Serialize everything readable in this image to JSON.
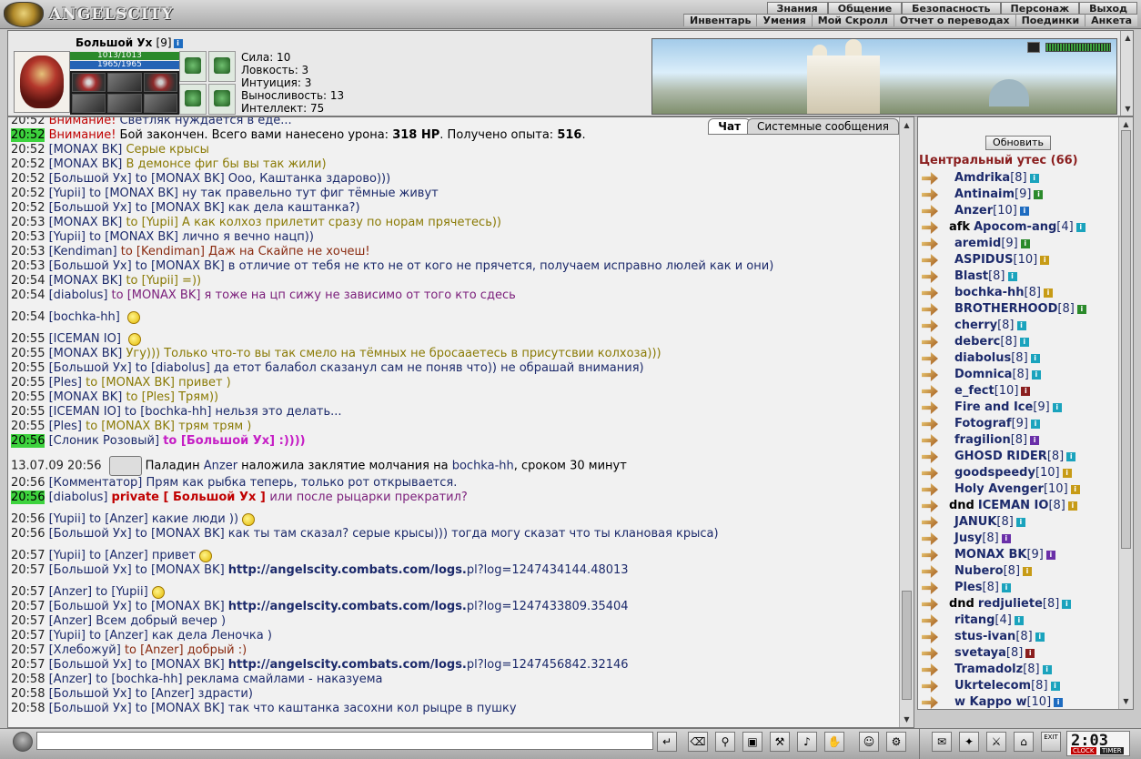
{
  "app": {
    "logo_text": "ANGELSCITY"
  },
  "menu": {
    "row1": [
      "Знания",
      "Общение",
      "Безопасность",
      "Персонаж",
      "Выход"
    ],
    "row2": [
      "Инвентарь",
      "Умения",
      "Мой Скролл",
      "Отчет о переводах",
      "Поединки",
      "Анкета"
    ]
  },
  "character": {
    "name": "Большой Ух",
    "level": "[9]",
    "hp": "1013/1013",
    "mana": "1965/1965",
    "stats": [
      "Сила: 10",
      "Ловкость: 3",
      "Интуиция: 3",
      "Выносливость: 13",
      "Интеллект: 75"
    ]
  },
  "chat": {
    "tabs": [
      "Чат",
      "Системные сообщения"
    ],
    "lines": [
      {
        "time": "20:52",
        "hl": false,
        "parts": [
          {
            "c": "red",
            "t": "Внимание! "
          },
          {
            "c": "msg",
            "t": "Светляк нуждается в еде..."
          }
        ]
      },
      {
        "time": "20:52",
        "hl": true,
        "parts": [
          {
            "c": "red",
            "t": "Внимание! "
          },
          {
            "c": "",
            "t": "Бой закончен. Всего вами нанесено урона: "
          },
          {
            "c": "bold",
            "t": "318 HP"
          },
          {
            "c": "",
            "t": ". Получено опыта: "
          },
          {
            "c": "bold",
            "t": "516"
          },
          {
            "c": "",
            "t": "."
          }
        ]
      },
      {
        "time": "20:52",
        "hl": false,
        "parts": [
          {
            "c": "nick",
            "t": "[MONAX BK] "
          },
          {
            "c": "olive",
            "t": "Серые крысы"
          }
        ]
      },
      {
        "time": "20:52",
        "hl": false,
        "parts": [
          {
            "c": "nick",
            "t": "[MONAX BK] "
          },
          {
            "c": "olive",
            "t": "В демонсе фиг бы вы так жили)"
          }
        ]
      },
      {
        "time": "20:52",
        "hl": false,
        "parts": [
          {
            "c": "nick",
            "t": "[Большой Ух] "
          },
          {
            "c": "to",
            "t": "to [MONAX BK] Ооо, Каштанка здарово)))"
          }
        ]
      },
      {
        "time": "20:52",
        "hl": false,
        "parts": [
          {
            "c": "nick",
            "t": "[Yupii] "
          },
          {
            "c": "to",
            "t": "to [MONAX BK] ну так правельно тут фиг тёмные живут"
          }
        ]
      },
      {
        "time": "20:52",
        "hl": false,
        "parts": [
          {
            "c": "nick",
            "t": "[Большой Ух] "
          },
          {
            "c": "to",
            "t": "to [MONAX BK] как дела каштанка?)"
          }
        ]
      },
      {
        "time": "20:53",
        "hl": false,
        "parts": [
          {
            "c": "nick",
            "t": "[MONAX BK] "
          },
          {
            "c": "olive",
            "t": "to [Yupii] А как колхоз прилетит сразу по норам прячетесь))"
          }
        ]
      },
      {
        "time": "20:53",
        "hl": false,
        "parts": [
          {
            "c": "nick",
            "t": "[Yupii] "
          },
          {
            "c": "to",
            "t": "to [MONAX BK] лично я вечно нацп))"
          }
        ]
      },
      {
        "time": "20:53",
        "hl": false,
        "parts": [
          {
            "c": "nick",
            "t": "[Kendiman] "
          },
          {
            "c": "brown",
            "t": "to [Kendiman] Даж на Скайпе не хочеш!"
          }
        ]
      },
      {
        "time": "20:53",
        "hl": false,
        "parts": [
          {
            "c": "nick",
            "t": "[Большой Ух] "
          },
          {
            "c": "to",
            "t": "to [MONAX BK] в отличие от тебя не кто не от кого не прячется, получаем исправно люлей как и они)"
          }
        ]
      },
      {
        "time": "20:54",
        "hl": false,
        "parts": [
          {
            "c": "nick",
            "t": "[MONAX BK] "
          },
          {
            "c": "olive",
            "t": "to [Yupii] =))"
          }
        ]
      },
      {
        "time": "20:54",
        "hl": false,
        "parts": [
          {
            "c": "nick",
            "t": "[diabolus] "
          },
          {
            "c": "purple",
            "t": "to [MONAX BK] я тоже на цп сижу не зависимо от того кто сдесь"
          }
        ]
      },
      {
        "time": "20:54",
        "hl": false,
        "tall": true,
        "smiley": true,
        "parts": [
          {
            "c": "nick",
            "t": "[bochka-hh] "
          }
        ]
      },
      {
        "time": "20:55",
        "hl": false,
        "tall": true,
        "smiley": true,
        "parts": [
          {
            "c": "nick",
            "t": "[ICEMAN IO] "
          }
        ]
      },
      {
        "time": "20:55",
        "hl": false,
        "parts": [
          {
            "c": "nick",
            "t": "[MONAX BK] "
          },
          {
            "c": "olive",
            "t": "Угу))) Только что-то вы так смело на тёмных не бросааетесь в присутсвии колхоза)))"
          }
        ]
      },
      {
        "time": "20:55",
        "hl": false,
        "parts": [
          {
            "c": "nick",
            "t": "[Большой Ух] "
          },
          {
            "c": "to",
            "t": "to [diabolus] да етот балабол сказанул сам не поняв что)) не обрашай внимания)"
          }
        ]
      },
      {
        "time": "20:55",
        "hl": false,
        "parts": [
          {
            "c": "nick",
            "t": "[Ples] "
          },
          {
            "c": "olive",
            "t": "to [MONAX BK] привет )"
          }
        ]
      },
      {
        "time": "20:55",
        "hl": false,
        "parts": [
          {
            "c": "nick",
            "t": "[MONAX BK] "
          },
          {
            "c": "olive",
            "t": "to [Ples] Трям))"
          }
        ]
      },
      {
        "time": "20:55",
        "hl": false,
        "parts": [
          {
            "c": "nick",
            "t": "[ICEMAN IO] "
          },
          {
            "c": "to",
            "t": "to [bochka-hh] нельзя это делать..."
          }
        ]
      },
      {
        "time": "20:55",
        "hl": false,
        "parts": [
          {
            "c": "nick",
            "t": "[Ples] "
          },
          {
            "c": "olive",
            "t": "to [MONAX BK] трям трям )"
          }
        ]
      },
      {
        "time": "20:56",
        "hl": true,
        "parts": [
          {
            "c": "nick",
            "t": "[Слоник Розовый] "
          },
          {
            "c": "magenta",
            "t": "to [Большой Ух]"
          },
          {
            "c": "magenta",
            "t": " :))))"
          }
        ]
      },
      {
        "time": "13.07.09 20:56",
        "hl": false,
        "tall": true,
        "emblem": true,
        "parts": [
          {
            "c": "",
            "t": "Паладин "
          },
          {
            "c": "nick",
            "t": "Anzer"
          },
          {
            "c": "",
            "t": " наложила заклятие молчания на "
          },
          {
            "c": "nick",
            "t": "bochka-hh"
          },
          {
            "c": "",
            "t": ", сроком 30 минут"
          }
        ]
      },
      {
        "time": "20:56",
        "hl": false,
        "parts": [
          {
            "c": "nick",
            "t": "[Комментатор] "
          },
          {
            "c": "msg",
            "t": "Прям как рыбка теперь, только рот открывается."
          }
        ]
      },
      {
        "time": "20:56",
        "hl": true,
        "parts": [
          {
            "c": "nick",
            "t": "[diabolus] "
          },
          {
            "c": "private",
            "t": "private [ Большой Ух ] "
          },
          {
            "c": "purple",
            "t": "или после рыцарки прекратил?"
          }
        ]
      },
      {
        "time": "20:56",
        "hl": false,
        "tall": true,
        "smiley": true,
        "parts": [
          {
            "c": "nick",
            "t": "[Yupii] "
          },
          {
            "c": "to",
            "t": "to [Anzer] какие люди ))"
          }
        ]
      },
      {
        "time": "20:56",
        "hl": false,
        "parts": [
          {
            "c": "nick",
            "t": "[Большой Ух] "
          },
          {
            "c": "to",
            "t": "to [MONAX BK] как ты там сказал? серые крысы))) тогда могу сказат что ты клановая крыса)"
          }
        ]
      },
      {
        "time": "20:57",
        "hl": false,
        "tall": true,
        "smiley": true,
        "parts": [
          {
            "c": "nick",
            "t": "[Yupii] "
          },
          {
            "c": "to",
            "t": "to [Anzer] привет"
          }
        ]
      },
      {
        "time": "20:57",
        "hl": false,
        "parts": [
          {
            "c": "nick",
            "t": "[Большой Ух] "
          },
          {
            "c": "to",
            "t": "to [MONAX BK] "
          },
          {
            "c": "url",
            "t": "http://angelscity.combats.com/logs."
          },
          {
            "c": "to",
            "t": "pl?log=1247434144.48013"
          }
        ]
      },
      {
        "time": "20:57",
        "hl": false,
        "tall": true,
        "smiley": true,
        "parts": [
          {
            "c": "nick",
            "t": "[Anzer] "
          },
          {
            "c": "to",
            "t": "to [Yupii]"
          }
        ]
      },
      {
        "time": "20:57",
        "hl": false,
        "parts": [
          {
            "c": "nick",
            "t": "[Большой Ух] "
          },
          {
            "c": "to",
            "t": "to [MONAX BK] "
          },
          {
            "c": "url",
            "t": "http://angelscity.combats.com/logs."
          },
          {
            "c": "to",
            "t": "pl?log=1247433809.35404"
          }
        ]
      },
      {
        "time": "20:57",
        "hl": false,
        "parts": [
          {
            "c": "nick",
            "t": "[Anzer] "
          },
          {
            "c": "msg",
            "t": "Всем добрый вечер )"
          }
        ]
      },
      {
        "time": "20:57",
        "hl": false,
        "parts": [
          {
            "c": "nick",
            "t": "[Yupii] "
          },
          {
            "c": "to",
            "t": "to [Anzer] как дела Леночка )"
          }
        ]
      },
      {
        "time": "20:57",
        "hl": false,
        "parts": [
          {
            "c": "nick",
            "t": "[Хлебожуй] "
          },
          {
            "c": "brown",
            "t": "to [Anzer] добрый :)"
          }
        ]
      },
      {
        "time": "20:57",
        "hl": false,
        "parts": [
          {
            "c": "nick",
            "t": "[Большой Ух] "
          },
          {
            "c": "to",
            "t": "to [MONAX BK] "
          },
          {
            "c": "url",
            "t": "http://angelscity.combats.com/logs."
          },
          {
            "c": "to",
            "t": "pl?log=1247456842.32146"
          }
        ]
      },
      {
        "time": "20:58",
        "hl": false,
        "parts": [
          {
            "c": "nick",
            "t": "[Anzer] "
          },
          {
            "c": "to",
            "t": "to [bochka-hh] реклама смайлами - наказуема"
          }
        ]
      },
      {
        "time": "20:58",
        "hl": false,
        "parts": [
          {
            "c": "nick",
            "t": "[Большой Ух] "
          },
          {
            "c": "to",
            "t": "to [Anzer] здрасти)"
          }
        ]
      },
      {
        "time": "20:58",
        "hl": false,
        "parts": [
          {
            "c": "nick",
            "t": "[Большой Ух] "
          },
          {
            "c": "to",
            "t": "to [MONAX BK] так что каштанка засохни кол рыцре в пушку"
          }
        ]
      }
    ]
  },
  "online": {
    "refresh_label": "Обновить",
    "location": "Центральный утес (66)",
    "users": [
      {
        "prefix": "",
        "name": "Amdrika",
        "level": "[8]",
        "badge": "cyan"
      },
      {
        "prefix": "",
        "name": "Antinaim",
        "level": "[9]",
        "badge": "green"
      },
      {
        "prefix": "",
        "name": "Anzer",
        "level": "[10]",
        "badge": "blue"
      },
      {
        "prefix": "afk",
        "name": "Apocom-ang",
        "level": "[4]",
        "badge": "cyan"
      },
      {
        "prefix": "",
        "name": "aremid",
        "level": "[9]",
        "badge": "green"
      },
      {
        "prefix": "",
        "name": "ASPIDUS",
        "level": "[10]",
        "badge": "gold"
      },
      {
        "prefix": "",
        "name": "Blast",
        "level": "[8]",
        "badge": "cyan"
      },
      {
        "prefix": "",
        "name": "bochka-hh",
        "level": "[8]",
        "badge": "gold"
      },
      {
        "prefix": "",
        "name": "BROTHERHOOD",
        "level": "[8]",
        "badge": "green"
      },
      {
        "prefix": "",
        "name": "cherry",
        "level": "[8]",
        "badge": "cyan"
      },
      {
        "prefix": "",
        "name": "deberc",
        "level": "[8]",
        "badge": "cyan"
      },
      {
        "prefix": "",
        "name": "diabolus",
        "level": "[8]",
        "badge": "cyan"
      },
      {
        "prefix": "",
        "name": "Domnica",
        "level": "[8]",
        "badge": "cyan"
      },
      {
        "prefix": "",
        "name": "e_fect",
        "level": "[10]",
        "badge": "darkred"
      },
      {
        "prefix": "",
        "name": "Fire and Ice",
        "level": "[9]",
        "badge": "cyan"
      },
      {
        "prefix": "",
        "name": "Fotograf",
        "level": "[9]",
        "badge": "cyan"
      },
      {
        "prefix": "",
        "name": "fragilion",
        "level": "[8]",
        "badge": "purple"
      },
      {
        "prefix": "",
        "name": "GHOSD RIDER",
        "level": "[8]",
        "badge": "cyan"
      },
      {
        "prefix": "",
        "name": "goodspeedy",
        "level": "[10]",
        "badge": "gold"
      },
      {
        "prefix": "",
        "name": "Holy Avenger",
        "level": "[10]",
        "badge": "gold"
      },
      {
        "prefix": "dnd",
        "name": "ICEMAN IO",
        "level": "[8]",
        "badge": "gold"
      },
      {
        "prefix": "",
        "name": "JANUK",
        "level": "[8]",
        "badge": "cyan"
      },
      {
        "prefix": "",
        "name": "Jusy",
        "level": "[8]",
        "badge": "purple"
      },
      {
        "prefix": "",
        "name": "MONAX BK",
        "level": "[9]",
        "badge": "purple"
      },
      {
        "prefix": "",
        "name": "Nubero",
        "level": "[8]",
        "badge": "gold"
      },
      {
        "prefix": "",
        "name": "Ples",
        "level": "[8]",
        "badge": "cyan"
      },
      {
        "prefix": "dnd",
        "name": "redjuliete",
        "level": "[8]",
        "badge": "cyan"
      },
      {
        "prefix": "",
        "name": "ritang",
        "level": "[4]",
        "badge": "cyan"
      },
      {
        "prefix": "",
        "name": "stus-ivan",
        "level": "[8]",
        "badge": "cyan"
      },
      {
        "prefix": "",
        "name": "svetaya",
        "level": "[8]",
        "badge": "darkred"
      },
      {
        "prefix": "",
        "name": "Tramadolz",
        "level": "[8]",
        "badge": "cyan"
      },
      {
        "prefix": "",
        "name": "Ukrtelecom",
        "level": "[8]",
        "badge": "cyan"
      },
      {
        "prefix": "",
        "name": "w Kappo w",
        "level": "[10]",
        "badge": "blue"
      }
    ]
  },
  "bottom": {
    "input_value": "",
    "clock_time": "2:03",
    "clock_label": "CLOCK",
    "timer_label": "TIMER",
    "exit_label": "EXIT"
  }
}
